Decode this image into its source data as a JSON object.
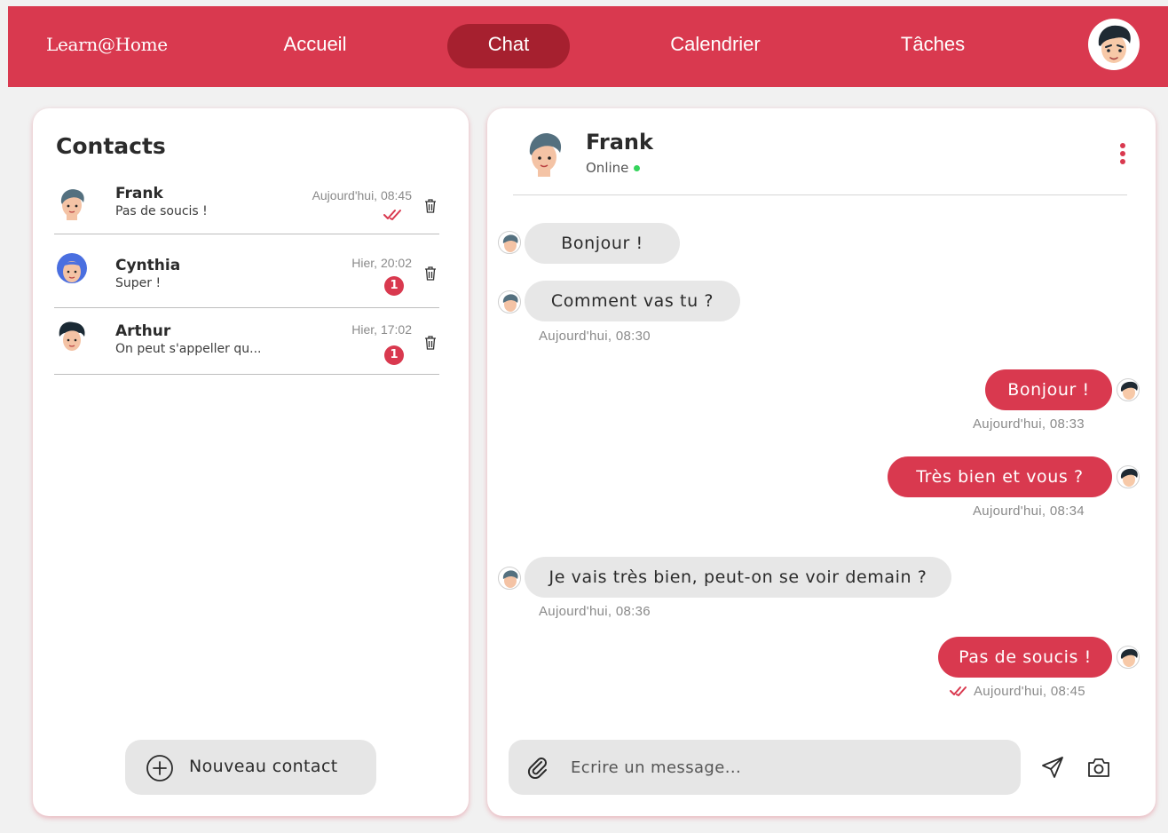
{
  "nav": {
    "brand": "Learn@Home",
    "items": [
      {
        "label": "Accueil"
      },
      {
        "label": "Chat",
        "active": true
      },
      {
        "label": "Calendrier"
      },
      {
        "label": "Tâches"
      }
    ]
  },
  "contacts": {
    "title": "Contacts",
    "list": [
      {
        "name": "Frank",
        "preview": "Pas de soucis !",
        "time": "Aujourd'hui, 08:45",
        "status": "read"
      },
      {
        "name": "Cynthia",
        "preview": "Super !",
        "time": "Hier, 20:02",
        "unread": "1"
      },
      {
        "name": "Arthur",
        "preview": "On peut s'appeller qu...",
        "time": "Hier, 17:02",
        "unread": "1"
      }
    ],
    "new_contact_label": "Nouveau contact"
  },
  "chat": {
    "contact_name": "Frank",
    "contact_status": "Online",
    "messages": [
      {
        "direction": "in",
        "text": "Bonjour !"
      },
      {
        "direction": "in",
        "text": "Comment vas tu ?",
        "time": "Aujourd'hui, 08:30"
      },
      {
        "direction": "out",
        "text": "Bonjour !",
        "time": "Aujourd'hui, 08:33"
      },
      {
        "direction": "out",
        "text": "Très bien et vous ?",
        "time": "Aujourd'hui, 08:34"
      },
      {
        "direction": "in",
        "text": "Je vais très bien, peut-on se voir demain ?",
        "time": "Aujourd'hui, 08:36"
      },
      {
        "direction": "out",
        "text": "Pas de soucis !",
        "time": "Aujourd'hui, 08:45",
        "read": true
      }
    ],
    "composer_placeholder": "Ecrire un message..."
  },
  "colors": {
    "primary": "#d9394f",
    "primary_dark": "#a6202f",
    "online": "#35d45c",
    "bubble_in": "#e7e7e7"
  },
  "icons": [
    "user-avatar-icon",
    "trash-icon",
    "double-check-icon",
    "plus-circle-icon",
    "kebab-menu-icon",
    "paperclip-icon",
    "send-icon",
    "camera-icon"
  ]
}
